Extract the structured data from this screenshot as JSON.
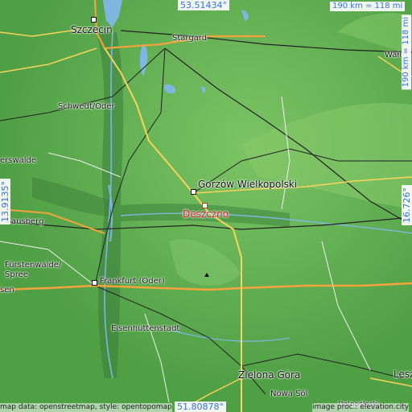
{
  "map": {
    "coords": {
      "top": "53.51434°",
      "bottom": "51.80878°",
      "left": "13.9135°",
      "right": "16.726°"
    },
    "scale_top": "190 km = 118 mi",
    "scale_right": "190 km = 118 mi",
    "credits": {
      "left": "map data: openstreetmap, style: opentopomap",
      "right": "image proc.: elevation.city"
    },
    "highlight": "Deszczno",
    "places": {
      "szczecin": "Szczecin",
      "stargard": "Stargard",
      "walcz": "Wałcz",
      "schwedt": "Schwedt/Oder",
      "gorzow": "Gorzów Wielkopolski",
      "erswalde": "erswalde",
      "ausberg": "ausberg",
      "furstenwalde": "Fürstenwalde/",
      "spree": "Spree",
      "frankfurt": "Frankfurt (Oder)",
      "sen": "sen",
      "eisenhuttenstadt": "Eisenhüttenstadt",
      "zielona": "Zielona Góra",
      "nowasol": "Nowa Sól",
      "lesz": "Lesz",
      "dolny": "Dolnośląski"
    },
    "colors": {
      "land": "#4f9f45",
      "land_light": "#7cc465",
      "land_dark": "#3a7d3a",
      "water": "#7fb6e0",
      "coord_text": "#3a6fe0",
      "highlight": "#d62a2a",
      "motorway": "#f3a33b",
      "major_road": "#f7d45a"
    }
  }
}
